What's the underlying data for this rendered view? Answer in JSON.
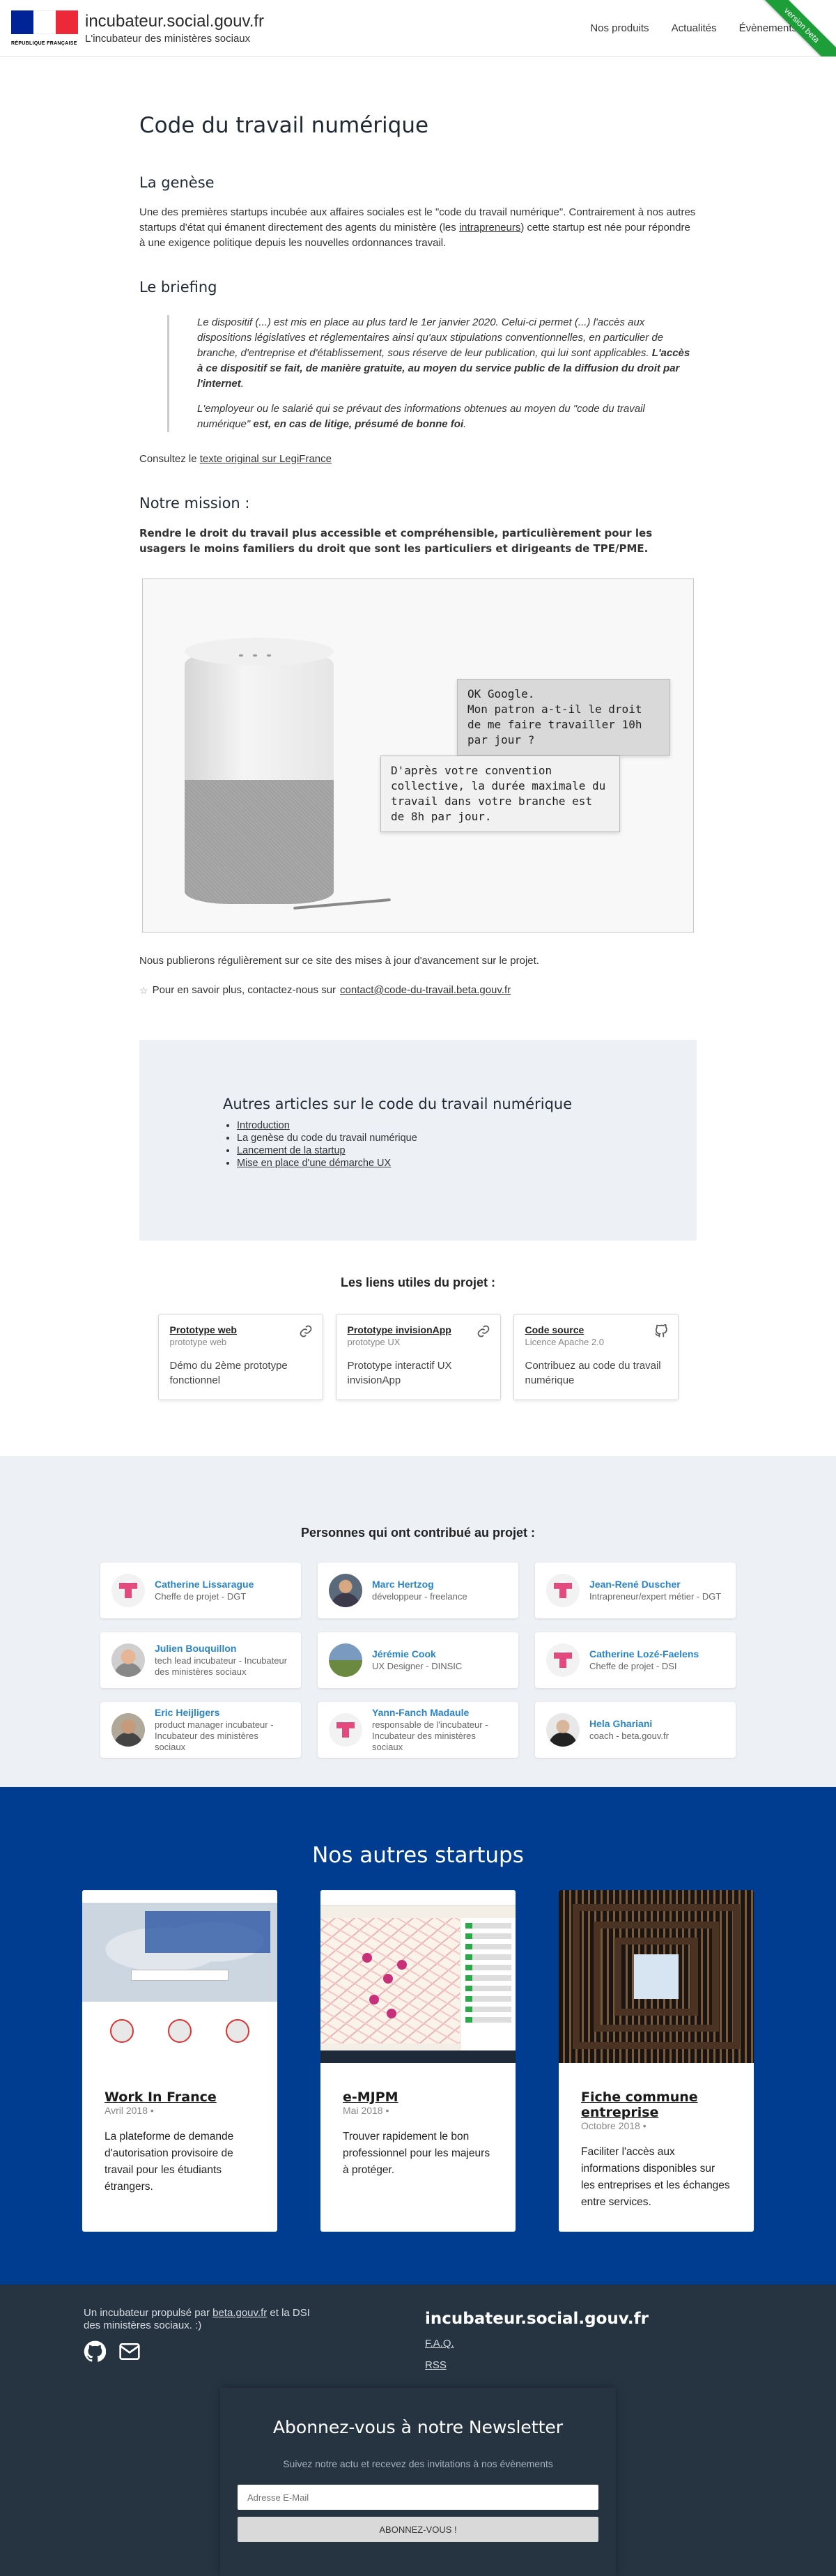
{
  "header": {
    "logo_caption": "RÉPUBLIQUE FRANÇAISE",
    "brand_title": "incubateur.social.gouv.fr",
    "brand_subtitle": "L'incubateur des ministères sociaux",
    "nav": [
      "Nos produits",
      "Actualités",
      "Évènements"
    ],
    "ribbon": "version beta",
    "flag_colors": [
      "#002395",
      "#ffffff",
      "#ed2939"
    ],
    "ribbon_color": "#1e9e39"
  },
  "article": {
    "title": "Code du travail numérique",
    "genese": {
      "heading": "La genèse",
      "text_before_link": "Une des premières startups incubée aux affaires sociales est le \"code du travail numérique\". Contrairement à nos autres startups d'état qui émanent directement des agents du ministère (les ",
      "link": "intrapreneurs",
      "text_after_link": ") cette startup est née pour répondre à une exigence politique depuis les nouvelles ordonnances travail."
    },
    "briefing": {
      "heading": "Le briefing",
      "quote1_normal": "Le dispositif (...) est mis en place au plus tard le 1er janvier 2020. Celui-ci permet (...) l'accès aux dispositions législatives et réglementaires ainsi qu'aux stipulations conventionnelles, en particulier de branche, d'entreprise et d'établissement, sous réserve de leur publication, qui lui sont applicables. ",
      "quote1_bold": "L'accès à ce dispositif se fait, de manière gratuite, au moyen du service public de la diffusion du droit par l'internet",
      "quote1_end": ".",
      "quote2_normal": "L'employeur ou le salarié qui se prévaut des informations obtenues au moyen du \"code du travail numérique\" ",
      "quote2_bold": "est, en cas de litige, présumé de bonne foi",
      "quote2_end": ".",
      "consult_prefix": "Consultez le ",
      "consult_link": "texte original sur LegiFrance"
    },
    "mission": {
      "heading": "Notre mission :",
      "intro": "Rendre le droit du travail plus accessible et compréhensible, particulièrement pour les usagers le moins familiers du droit que sont les particuliers et dirigeants de TPE/PME.",
      "bubble_question": "OK Google.\nMon patron a-t-il le droit de me faire travailler 10h par jour ?",
      "bubble_answer": "D'après votre convention collective, la durée maximale du travail dans votre branche est de 8h par jour."
    },
    "updates": "Nous publierons régulièrement sur ce site des mises à jour d'avancement sur le projet.",
    "contact_prefix": "Pour en savoir plus, contactez-nous sur ",
    "contact_email": "contact@code-du-travail.beta.gouv.fr"
  },
  "other_articles": {
    "heading": "Autres articles sur le code du travail numérique",
    "items": [
      {
        "label": "Introduction",
        "link": true
      },
      {
        "label": "La genèse du code du travail numérique",
        "link": false
      },
      {
        "label": "Lancement de la startup",
        "link": true
      },
      {
        "label": "Mise en place d'une démarche UX",
        "link": true
      }
    ]
  },
  "useful_links": {
    "heading": "Les liens utiles du projet :",
    "cards": [
      {
        "title": "Prototype web",
        "subtitle": "prototype web",
        "desc": "Démo du 2ème prototype fonctionnel",
        "icon": "link-icon"
      },
      {
        "title": "Prototype invisionApp",
        "subtitle": "prototype UX",
        "desc": "Prototype interactif UX invisionApp",
        "icon": "link-icon"
      },
      {
        "title": "Code source",
        "subtitle": "Licence Apache 2.0",
        "desc": "Contribuez au code du travail numérique",
        "icon": "github-icon"
      }
    ]
  },
  "contributors": {
    "heading": "Personnes qui ont contribué au projet :",
    "people": [
      {
        "name": "Catherine Lissarague",
        "role": "Cheffe de projet - DGT",
        "avatar": "pattern"
      },
      {
        "name": "Marc Hertzog",
        "role": "développeur - freelance",
        "avatar": "photo1"
      },
      {
        "name": "Jean-René Duscher",
        "role": "Intrapreneur/expert métier - DGT",
        "avatar": "pattern"
      },
      {
        "name": "Julien Bouquillon",
        "role": "tech lead incubateur - Incubateur des ministères sociaux",
        "avatar": "photo2"
      },
      {
        "name": "Jérémie Cook",
        "role": "UX Designer - DINSIC",
        "avatar": "photo3"
      },
      {
        "name": "Catherine Lozé-Faelens",
        "role": "Cheffe de projet - DSI",
        "avatar": "pattern"
      },
      {
        "name": "Eric Heijligers",
        "role": "product manager incubateur - Incubateur des ministères sociaux",
        "avatar": "photo4"
      },
      {
        "name": "Yann-Fanch Madaule",
        "role": "responsable de l'incubateur - Incubateur des ministères sociaux",
        "avatar": "pattern"
      },
      {
        "name": "Hela Ghariani",
        "role": "coach - beta.gouv.fr",
        "avatar": "photo5"
      }
    ]
  },
  "startups": {
    "heading": "Nos autres startups",
    "cards": [
      {
        "name": "Work In France",
        "date": "Avril 2018 •",
        "desc": "La plateforme de demande d'autorisation provisoire de travail pour les étudiants étrangers.",
        "thumb": "wif"
      },
      {
        "name": "e-MJPM",
        "date": "Mai 2018 •",
        "desc": "Trouver rapidement le bon professionnel pour les majeurs à protéger.",
        "thumb": "mjpm"
      },
      {
        "name": "Fiche commune entreprise",
        "date": "Octobre 2018 •",
        "desc": "Faciliter l'accès aux informations disponibles sur les entreprises et les échanges entre services.",
        "thumb": "fce"
      }
    ],
    "bg_color": "#003c8f"
  },
  "footer": {
    "text_prefix": "Un incubateur propulsé par ",
    "text_link": "beta.gouv.fr",
    "text_suffix": " et la DSI des ministères sociaux. :)",
    "brand": "incubateur.social.gouv.fr",
    "links": [
      "F.A.Q.",
      "RSS"
    ],
    "social_icons": [
      "github-icon",
      "mail-icon"
    ],
    "bg_color": "#263442"
  },
  "newsletter": {
    "title": "Abonnez-vous à notre Newsletter",
    "subtitle": "Suivez notre actu et recevez des invitations à nos évènements",
    "email_placeholder": "Adresse E-Mail",
    "button": "ABONNEZ-VOUS !"
  }
}
